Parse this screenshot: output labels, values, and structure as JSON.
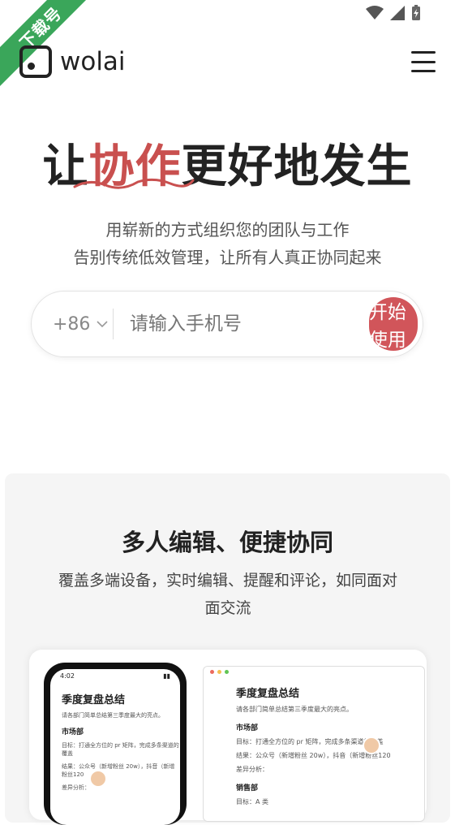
{
  "corner_badge": "下载号",
  "header": {
    "logo_text": "wolai"
  },
  "hero": {
    "title_part1": "让",
    "title_accent": "协作",
    "title_part2": "更好地发生",
    "subtitle_line1": "用崭新的方式组织您的团队与工作",
    "subtitle_line2": "告别传统低效管理，让所有人真正协同起来"
  },
  "signup": {
    "country_code": "+86",
    "phone_placeholder": "请输入手机号",
    "start_label": "开始使用"
  },
  "feature": {
    "title": "多人编辑、便捷协同",
    "desc_line1": "覆盖多端设备，实时编辑、提醒和评论，如同面对",
    "desc_line2": "面交流",
    "mock": {
      "phone_time": "4:02",
      "doc_title": "季度复盘总结",
      "doc_note": "请各部门简单总结第三季度最大的亮点。",
      "section1": "市场部",
      "bullet1": "目标：打通全方位的 pr 矩阵，完成多条渠道的覆盖",
      "bullet2": "结果：公众号（新增粉丝 20w），抖音（新增粉丝120",
      "bullet3": "差异分析：",
      "section2": "销售部",
      "bullet4": "目标：A 类"
    }
  },
  "colors": {
    "accent": "#c9504f",
    "button": "#d1555a",
    "badge": "#3aa65a"
  }
}
